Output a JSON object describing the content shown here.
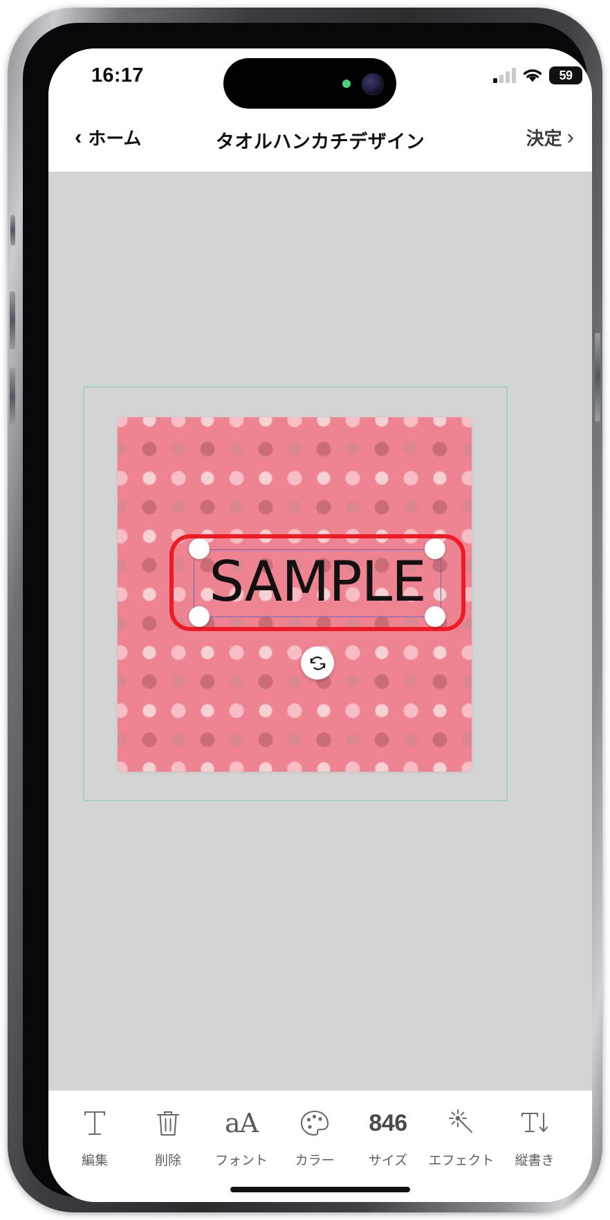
{
  "status_bar": {
    "time": "16:17",
    "battery_level": "59",
    "cellular_icon": "cellular-bars-icon",
    "wifi_icon": "wifi-icon",
    "battery_icon": "battery-icon",
    "island_camera_icon": "front-camera-icon",
    "island_indicator_icon": "green-privacy-dot-icon"
  },
  "nav_bar": {
    "back_label": "ホーム",
    "back_chevron": "‹",
    "title": "タオルハンカチデザイン",
    "confirm_label": "決定",
    "confirm_chevron": "›"
  },
  "canvas": {
    "guide_frame_color": "#a7cdc4",
    "background_color": "#d4d4d4",
    "fabric": {
      "base_color": "#ee8392",
      "dot_light_color": "#f9c2c9",
      "dot_dark_color": "#c96b75",
      "pattern": "polka-dot"
    },
    "text_object": {
      "value": "SAMPLE",
      "selection_border_color": "#ed1c24",
      "inner_box_color": "#6b62c6",
      "handle_color": "#ffffff",
      "rotate_icon": "rotate-refresh-icon"
    }
  },
  "toolbar": {
    "items": [
      {
        "icon": "text-t-icon",
        "label": "編集"
      },
      {
        "icon": "trash-icon",
        "label": "削除"
      },
      {
        "icon": "font-aa-icon",
        "label": "フォント"
      },
      {
        "icon": "color-palette-icon",
        "label": "カラー"
      },
      {
        "icon": "size-value",
        "label": "サイズ",
        "value": "846"
      },
      {
        "icon": "sparkle-wand-icon",
        "label": "エフェクト"
      },
      {
        "icon": "vertical-text-icon",
        "label": "縦書き"
      }
    ]
  },
  "home_indicator": "home-indicator-bar"
}
